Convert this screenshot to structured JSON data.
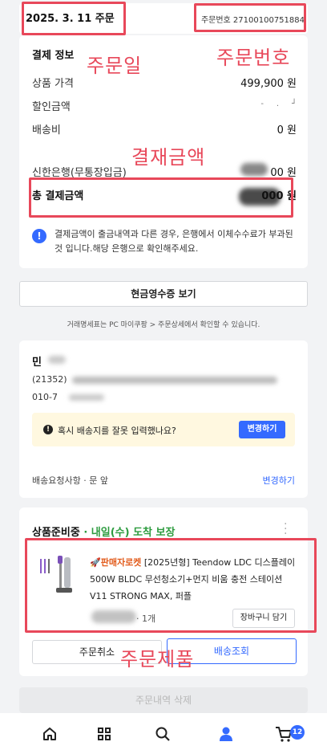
{
  "order": {
    "date": "2025. 3. 11 주문",
    "number": "주문번호 27100100751884"
  },
  "annotations": {
    "order_date": "주문일",
    "order_number": "주문번호",
    "payment_amount": "결재금액",
    "ordered_product": "주문제품"
  },
  "payment": {
    "title": "결제 정보",
    "rows": [
      {
        "label": "상품 가격",
        "value": "499,900 원"
      },
      {
        "label": "할인금액",
        "value": ""
      },
      {
        "label": "배송비",
        "value": "0 원"
      }
    ],
    "bank_label": "신한은행(무통장입금)",
    "bank_value": "00 원",
    "total_label": "총 결제금액",
    "total_value": "000 원",
    "notice": "결제금액이 출금내역과 다른 경우, 은행에서 이체수수료가 부과된 것 입니다.해당 은행으로 확인해주세요."
  },
  "receipt": {
    "button": "현금영수증 보기",
    "note": "거래명세표는 PC 마이쿠팡 > 주문상세에서 확인할 수 있습니다."
  },
  "shipping": {
    "name": "민",
    "zip": "(21352)",
    "phone": "010-7",
    "alert": "혹시 배송지를 잘못 입력했나요?",
    "change_button": "변경하기",
    "request_label": "배송요청사항 · 문 앞",
    "request_change": "변경하기"
  },
  "product": {
    "status": "상품준비중",
    "delivery": "· 내일(수) 도착 보장",
    "badge": "판매자로켓",
    "name": "[2025년형] Teendow LDC 디스플레이 500W BLDC 무선청소기+먼지 비움 충전 스테이션 V11 STRONG MAX, 퍼플",
    "qty": "· 1개",
    "cart_button": "장바구니 담기",
    "cancel_button": "주문취소",
    "track_button": "배송조회",
    "delete_button": "주문내역 삭제"
  },
  "nav": {
    "cart_count": "12"
  },
  "colors": {
    "accent_blue": "#346aff",
    "green": "#2c9b3e",
    "annotation_red": "#e8485a",
    "rocket_orange": "#e25b1b"
  }
}
